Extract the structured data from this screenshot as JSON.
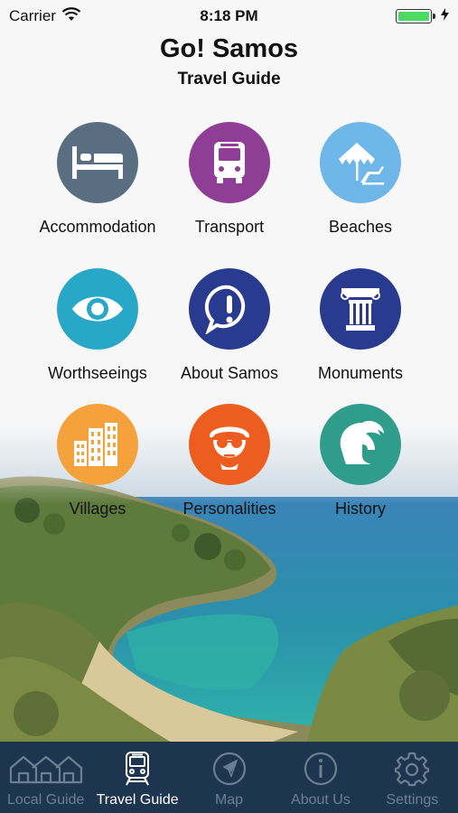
{
  "status_bar": {
    "carrier": "Carrier",
    "time": "8:18 PM",
    "battery_level": 1.0,
    "battery_color": "#4cd964"
  },
  "header": {
    "title": "Go! Samos",
    "subtitle": "Travel Guide"
  },
  "grid": {
    "items": [
      {
        "label": "Accommodation",
        "icon": "bed-icon",
        "color": "#596f81"
      },
      {
        "label": "Transport",
        "icon": "bus-icon",
        "color": "#8e3f95"
      },
      {
        "label": "Beaches",
        "icon": "beach-umbrella-icon",
        "color": "#6fb7e8"
      },
      {
        "label": "Worthseeings",
        "icon": "eye-icon",
        "color": "#29a7c6"
      },
      {
        "label": "About Samos",
        "icon": "info-bubble-icon",
        "color": "#283b8f"
      },
      {
        "label": "Monuments",
        "icon": "column-icon",
        "color": "#283b8f"
      },
      {
        "label": "Villages",
        "icon": "buildings-icon",
        "color": "#f6a23c"
      },
      {
        "label": "Personalities",
        "icon": "face-glasses-icon",
        "color": "#ec5d1f"
      },
      {
        "label": "History",
        "icon": "spartan-helmet-icon",
        "color": "#2f9c8c"
      }
    ]
  },
  "tab_bar": {
    "background": "#1e3550",
    "tabs": [
      {
        "label": "Local Guide",
        "icon": "houses-icon",
        "active": false
      },
      {
        "label": "Travel Guide",
        "icon": "train-icon",
        "active": true
      },
      {
        "label": "Map",
        "icon": "compass-icon",
        "active": false
      },
      {
        "label": "About Us",
        "icon": "info-icon",
        "active": false
      },
      {
        "label": "Settings",
        "icon": "gear-icon",
        "active": false
      }
    ]
  }
}
